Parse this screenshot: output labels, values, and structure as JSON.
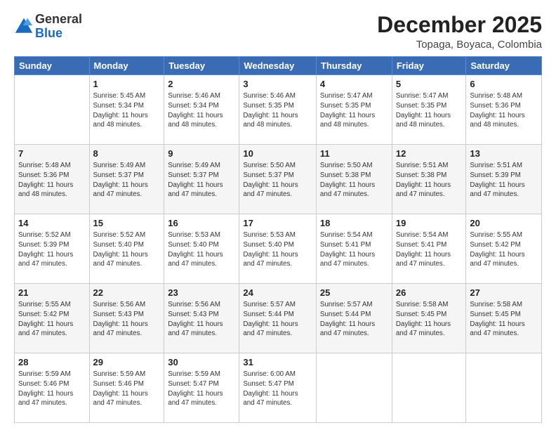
{
  "logo": {
    "general": "General",
    "blue": "Blue"
  },
  "title": "December 2025",
  "subtitle": "Topaga, Boyaca, Colombia",
  "days_header": [
    "Sunday",
    "Monday",
    "Tuesday",
    "Wednesday",
    "Thursday",
    "Friday",
    "Saturday"
  ],
  "weeks": [
    [
      {
        "num": "",
        "info": ""
      },
      {
        "num": "1",
        "info": "Sunrise: 5:45 AM\nSunset: 5:34 PM\nDaylight: 11 hours\nand 48 minutes."
      },
      {
        "num": "2",
        "info": "Sunrise: 5:46 AM\nSunset: 5:34 PM\nDaylight: 11 hours\nand 48 minutes."
      },
      {
        "num": "3",
        "info": "Sunrise: 5:46 AM\nSunset: 5:35 PM\nDaylight: 11 hours\nand 48 minutes."
      },
      {
        "num": "4",
        "info": "Sunrise: 5:47 AM\nSunset: 5:35 PM\nDaylight: 11 hours\nand 48 minutes."
      },
      {
        "num": "5",
        "info": "Sunrise: 5:47 AM\nSunset: 5:35 PM\nDaylight: 11 hours\nand 48 minutes."
      },
      {
        "num": "6",
        "info": "Sunrise: 5:48 AM\nSunset: 5:36 PM\nDaylight: 11 hours\nand 48 minutes."
      }
    ],
    [
      {
        "num": "7",
        "info": "Sunrise: 5:48 AM\nSunset: 5:36 PM\nDaylight: 11 hours\nand 48 minutes."
      },
      {
        "num": "8",
        "info": "Sunrise: 5:49 AM\nSunset: 5:37 PM\nDaylight: 11 hours\nand 47 minutes."
      },
      {
        "num": "9",
        "info": "Sunrise: 5:49 AM\nSunset: 5:37 PM\nDaylight: 11 hours\nand 47 minutes."
      },
      {
        "num": "10",
        "info": "Sunrise: 5:50 AM\nSunset: 5:37 PM\nDaylight: 11 hours\nand 47 minutes."
      },
      {
        "num": "11",
        "info": "Sunrise: 5:50 AM\nSunset: 5:38 PM\nDaylight: 11 hours\nand 47 minutes."
      },
      {
        "num": "12",
        "info": "Sunrise: 5:51 AM\nSunset: 5:38 PM\nDaylight: 11 hours\nand 47 minutes."
      },
      {
        "num": "13",
        "info": "Sunrise: 5:51 AM\nSunset: 5:39 PM\nDaylight: 11 hours\nand 47 minutes."
      }
    ],
    [
      {
        "num": "14",
        "info": "Sunrise: 5:52 AM\nSunset: 5:39 PM\nDaylight: 11 hours\nand 47 minutes."
      },
      {
        "num": "15",
        "info": "Sunrise: 5:52 AM\nSunset: 5:40 PM\nDaylight: 11 hours\nand 47 minutes."
      },
      {
        "num": "16",
        "info": "Sunrise: 5:53 AM\nSunset: 5:40 PM\nDaylight: 11 hours\nand 47 minutes."
      },
      {
        "num": "17",
        "info": "Sunrise: 5:53 AM\nSunset: 5:40 PM\nDaylight: 11 hours\nand 47 minutes."
      },
      {
        "num": "18",
        "info": "Sunrise: 5:54 AM\nSunset: 5:41 PM\nDaylight: 11 hours\nand 47 minutes."
      },
      {
        "num": "19",
        "info": "Sunrise: 5:54 AM\nSunset: 5:41 PM\nDaylight: 11 hours\nand 47 minutes."
      },
      {
        "num": "20",
        "info": "Sunrise: 5:55 AM\nSunset: 5:42 PM\nDaylight: 11 hours\nand 47 minutes."
      }
    ],
    [
      {
        "num": "21",
        "info": "Sunrise: 5:55 AM\nSunset: 5:42 PM\nDaylight: 11 hours\nand 47 minutes."
      },
      {
        "num": "22",
        "info": "Sunrise: 5:56 AM\nSunset: 5:43 PM\nDaylight: 11 hours\nand 47 minutes."
      },
      {
        "num": "23",
        "info": "Sunrise: 5:56 AM\nSunset: 5:43 PM\nDaylight: 11 hours\nand 47 minutes."
      },
      {
        "num": "24",
        "info": "Sunrise: 5:57 AM\nSunset: 5:44 PM\nDaylight: 11 hours\nand 47 minutes."
      },
      {
        "num": "25",
        "info": "Sunrise: 5:57 AM\nSunset: 5:44 PM\nDaylight: 11 hours\nand 47 minutes."
      },
      {
        "num": "26",
        "info": "Sunrise: 5:58 AM\nSunset: 5:45 PM\nDaylight: 11 hours\nand 47 minutes."
      },
      {
        "num": "27",
        "info": "Sunrise: 5:58 AM\nSunset: 5:45 PM\nDaylight: 11 hours\nand 47 minutes."
      }
    ],
    [
      {
        "num": "28",
        "info": "Sunrise: 5:59 AM\nSunset: 5:46 PM\nDaylight: 11 hours\nand 47 minutes."
      },
      {
        "num": "29",
        "info": "Sunrise: 5:59 AM\nSunset: 5:46 PM\nDaylight: 11 hours\nand 47 minutes."
      },
      {
        "num": "30",
        "info": "Sunrise: 5:59 AM\nSunset: 5:47 PM\nDaylight: 11 hours\nand 47 minutes."
      },
      {
        "num": "31",
        "info": "Sunrise: 6:00 AM\nSunset: 5:47 PM\nDaylight: 11 hours\nand 47 minutes."
      },
      {
        "num": "",
        "info": ""
      },
      {
        "num": "",
        "info": ""
      },
      {
        "num": "",
        "info": ""
      }
    ]
  ]
}
